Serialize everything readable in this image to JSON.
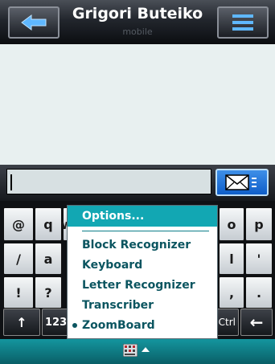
{
  "header": {
    "title": "Grigori Buteiko",
    "subtitle": "mobile"
  },
  "compose": {
    "value": ""
  },
  "keyboard": {
    "row1": [
      "@",
      "q",
      "w",
      "o",
      "p"
    ],
    "row2": [
      "/",
      "a",
      "l",
      "'"
    ],
    "row3": [
      "!",
      "?",
      ",",
      "."
    ],
    "row4": {
      "shift": "↑",
      "num": "123",
      "ctrl": "Ctrl",
      "backspace": "←"
    }
  },
  "popup": {
    "header": "Options...",
    "items": [
      "Block Recognizer",
      "Keyboard",
      "Letter Recognizer",
      "Transcriber",
      "ZoomBoard"
    ],
    "selected_index": 4
  },
  "icons": {
    "back": "back-arrow-icon",
    "menu": "hamburger-menu-icon",
    "send": "envelope-icon",
    "input_panel": "keyboard-grid-icon",
    "input_panel_toggle": "caret-up-icon"
  },
  "colors": {
    "accent": "#12a7b3",
    "send": "#2a7ee0",
    "menu_text": "#0b5560"
  }
}
